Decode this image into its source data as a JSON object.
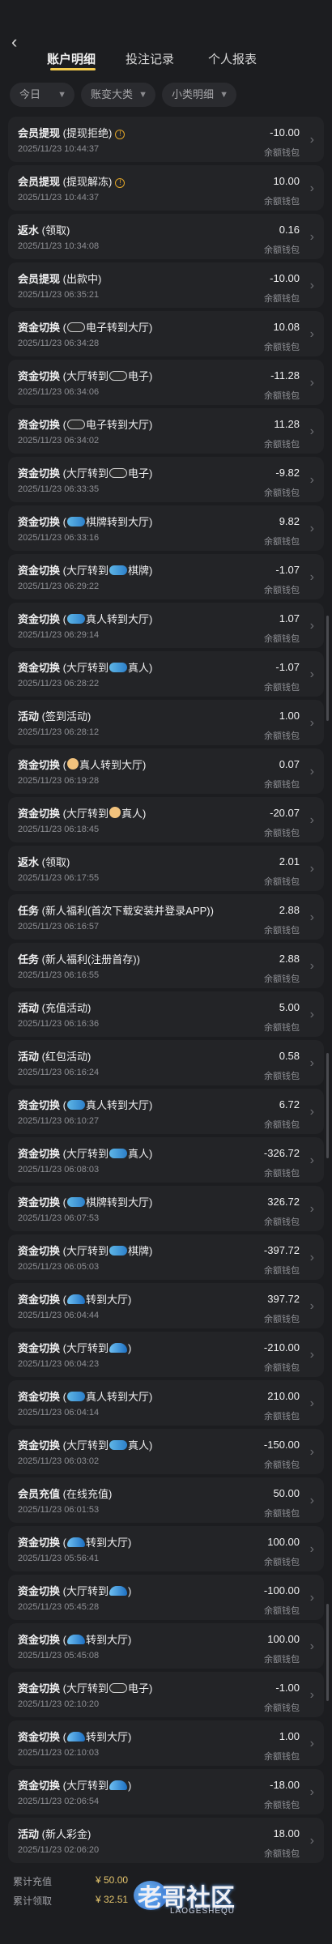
{
  "tabs": [
    "账户明细",
    "投注记录",
    "个人报表"
  ],
  "filters": {
    "date": "今日",
    "main_type": "账变大类",
    "sub_type": "小类明细"
  },
  "rows": [
    {
      "kind": "会员提现",
      "detail": "提现拒绝",
      "icon": "warn",
      "time": "2025/11/23 10:44:37",
      "amount": "-10.00",
      "account": "余额钱包"
    },
    {
      "kind": "会员提现",
      "detail": "提现解冻",
      "icon": "warn",
      "time": "2025/11/23 10:44:37",
      "amount": "10.00",
      "account": "余额钱包"
    },
    {
      "kind": "返水",
      "detail": "领取",
      "icon": "",
      "time": "2025/11/23 10:34:08",
      "amount": "0.16",
      "account": "余额钱包"
    },
    {
      "kind": "会员提现",
      "detail": "出款中",
      "icon": "",
      "time": "2025/11/23 06:35:21",
      "amount": "-10.00",
      "account": "余额钱包"
    },
    {
      "kind": "资金切换",
      "detail": "电子转到大厅",
      "pre": "pg",
      "time": "2025/11/23 06:34:28",
      "amount": "10.08",
      "account": "余额钱包"
    },
    {
      "kind": "资金切换",
      "detail": "大厅转到",
      "post": "pg",
      "tail": "电子",
      "time": "2025/11/23 06:34:06",
      "amount": "-11.28",
      "account": "余额钱包"
    },
    {
      "kind": "资金切换",
      "detail": "电子转到大厅",
      "pre": "pg",
      "time": "2025/11/23 06:34:02",
      "amount": "11.28",
      "account": "余额钱包"
    },
    {
      "kind": "资金切换",
      "detail": "大厅转到",
      "post": "pg",
      "tail": "电子",
      "time": "2025/11/23 06:33:35",
      "amount": "-9.82",
      "account": "余额钱包"
    },
    {
      "kind": "资金切换",
      "detail": "棋牌转到大厅",
      "pre": "fish",
      "time": "2025/11/23 06:33:16",
      "amount": "9.82",
      "account": "余额钱包"
    },
    {
      "kind": "资金切换",
      "detail": "大厅转到",
      "post": "fish",
      "tail": "棋牌",
      "time": "2025/11/23 06:29:22",
      "amount": "-1.07",
      "account": "余额钱包"
    },
    {
      "kind": "资金切换",
      "detail": "真人转到大厅",
      "pre": "fish",
      "time": "2025/11/23 06:29:14",
      "amount": "1.07",
      "account": "余额钱包"
    },
    {
      "kind": "资金切换",
      "detail": "大厅转到",
      "post": "fish",
      "tail": "真人",
      "time": "2025/11/23 06:28:22",
      "amount": "-1.07",
      "account": "余额钱包"
    },
    {
      "kind": "活动",
      "detail": "签到活动",
      "icon": "",
      "time": "2025/11/23 06:28:12",
      "amount": "1.00",
      "account": "余额钱包"
    },
    {
      "kind": "资金切换",
      "detail": "真人转到大厅",
      "pre": "face",
      "time": "2025/11/23 06:19:28",
      "amount": "0.07",
      "account": "余额钱包"
    },
    {
      "kind": "资金切换",
      "detail": "大厅转到",
      "post": "face",
      "tail": "真人",
      "time": "2025/11/23 06:18:45",
      "amount": "-20.07",
      "account": "余额钱包"
    },
    {
      "kind": "返水",
      "detail": "领取",
      "icon": "",
      "time": "2025/11/23 06:17:55",
      "amount": "2.01",
      "account": "余额钱包"
    },
    {
      "kind": "任务",
      "detail": "新人福利(首次下载安装并登录APP)",
      "icon": "",
      "time": "2025/11/23 06:16:57",
      "amount": "2.88",
      "account": "余额钱包"
    },
    {
      "kind": "任务",
      "detail": "新人福利(注册首存)",
      "icon": "",
      "time": "2025/11/23 06:16:55",
      "amount": "2.88",
      "account": "余额钱包"
    },
    {
      "kind": "活动",
      "detail": "充值活动",
      "icon": "",
      "time": "2025/11/23 06:16:36",
      "amount": "5.00",
      "account": "余额钱包"
    },
    {
      "kind": "活动",
      "detail": "红包活动",
      "icon": "",
      "time": "2025/11/23 06:16:24",
      "amount": "0.58",
      "account": "余额钱包"
    },
    {
      "kind": "资金切换",
      "detail": "真人转到大厅",
      "pre": "fish",
      "time": "2025/11/23 06:10:27",
      "amount": "6.72",
      "account": "余额钱包"
    },
    {
      "kind": "资金切换",
      "detail": "大厅转到",
      "post": "fish",
      "tail": "真人",
      "time": "2025/11/23 06:08:03",
      "amount": "-326.72",
      "account": "余额钱包"
    },
    {
      "kind": "资金切换",
      "detail": "棋牌转到大厅",
      "pre": "fish",
      "time": "2025/11/23 06:07:53",
      "amount": "326.72",
      "account": "余额钱包"
    },
    {
      "kind": "资金切换",
      "detail": "大厅转到",
      "post": "fish",
      "tail": "棋牌",
      "time": "2025/11/23 06:05:03",
      "amount": "-397.72",
      "account": "余额钱包"
    },
    {
      "kind": "资金切换",
      "detail": "转到大厅",
      "pre": "wave",
      "time": "2025/11/23 06:04:44",
      "amount": "397.72",
      "account": "余额钱包"
    },
    {
      "kind": "资金切换",
      "detail": "大厅转到",
      "post": "wave",
      "tail": "",
      "time": "2025/11/23 06:04:23",
      "amount": "-210.00",
      "account": "余额钱包"
    },
    {
      "kind": "资金切换",
      "detail": "真人转到大厅",
      "pre": "fish",
      "time": "2025/11/23 06:04:14",
      "amount": "210.00",
      "account": "余额钱包"
    },
    {
      "kind": "资金切换",
      "detail": "大厅转到",
      "post": "fish",
      "tail": "真人",
      "time": "2025/11/23 06:03:02",
      "amount": "-150.00",
      "account": "余额钱包"
    },
    {
      "kind": "会员充值",
      "detail": "在线充值",
      "icon": "",
      "time": "2025/11/23 06:01:53",
      "amount": "50.00",
      "account": "余额钱包"
    },
    {
      "kind": "资金切换",
      "detail": "转到大厅",
      "pre": "wave",
      "time": "2025/11/23 05:56:41",
      "amount": "100.00",
      "account": "余额钱包"
    },
    {
      "kind": "资金切换",
      "detail": "大厅转到",
      "post": "wave",
      "tail": "",
      "time": "2025/11/23 05:45:28",
      "amount": "-100.00",
      "account": "余额钱包"
    },
    {
      "kind": "资金切换",
      "detail": "转到大厅",
      "pre": "wave",
      "time": "2025/11/23 05:45:08",
      "amount": "100.00",
      "account": "余额钱包"
    },
    {
      "kind": "资金切换",
      "detail": "大厅转到",
      "post": "pg",
      "tail": "电子",
      "time": "2025/11/23 02:10:20",
      "amount": "-1.00",
      "account": "余额钱包"
    },
    {
      "kind": "资金切换",
      "detail": "转到大厅",
      "pre": "wave",
      "time": "2025/11/23 02:10:03",
      "amount": "1.00",
      "account": "余额钱包"
    },
    {
      "kind": "资金切换",
      "detail": "大厅转到",
      "post": "wave",
      "tail": "",
      "time": "2025/11/23 02:06:54",
      "amount": "-18.00",
      "account": "余额钱包"
    },
    {
      "kind": "活动",
      "detail": "新人彩金",
      "icon": "",
      "time": "2025/11/23 02:06:20",
      "amount": "18.00",
      "account": "余额钱包"
    }
  ],
  "footer": {
    "total_recharge_label": "累计充值",
    "total_recharge_value": "¥ 50.00",
    "total_withdraw_label": "累计领取",
    "total_withdraw_value": "¥ 32.51"
  },
  "watermark": {
    "title": "老哥社区",
    "subtitle": "LAOGESHEQU"
  }
}
